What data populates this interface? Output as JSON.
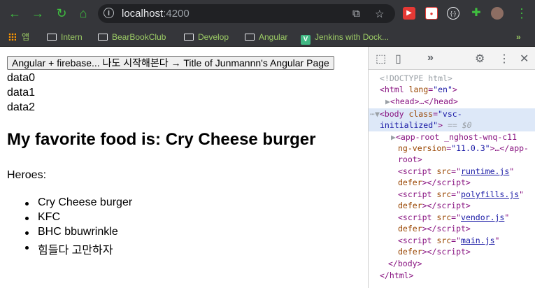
{
  "browser": {
    "url_host": "localhost",
    "url_port": ":4200",
    "bookmarks": [
      {
        "label": "앱"
      },
      {
        "label": "Intern"
      },
      {
        "label": "BearBookClub"
      },
      {
        "label": "Develop"
      },
      {
        "label": "Angular"
      },
      {
        "label": "Jenkins with Dock..."
      }
    ],
    "bookmarks_overflow": "»"
  },
  "page": {
    "title_button": "Angular + firebase... 나도 시작해본다 → Title of Junmannn's Angular Page",
    "data_lines": [
      "data0",
      "data1",
      "data2"
    ],
    "heading": "My favorite food is: Cry Cheese burger",
    "heroes_label": "Heroes:",
    "heroes": [
      "Cry Cheese burger",
      "KFC",
      "BHC bbuwrinkle",
      "힘들다 고만하자"
    ]
  },
  "devtools": {
    "doctype": "<!DOCTYPE html>",
    "html_open_tag": "<html",
    "html_lang_attr": "lang",
    "html_lang_val": "\"en\"",
    "head_line": "<head>…</head>",
    "body_open": "<body",
    "body_class_attr": "class",
    "body_class_val": "\"vsc-",
    "body_class_val2": "initialized\"",
    "body_eq": "== $0",
    "app_root_1": "<app-root _nghost-wnq-c11",
    "app_root_2": "ng-version",
    "app_root_2_val": "\"11.0.3\"",
    "app_root_2_end": ">…</app-",
    "app_root_3": "root>",
    "scripts": [
      "runtime.js",
      "polyfills.js",
      "vendor.js",
      "main.js"
    ],
    "body_close": "</body>",
    "html_close": "</html>"
  }
}
